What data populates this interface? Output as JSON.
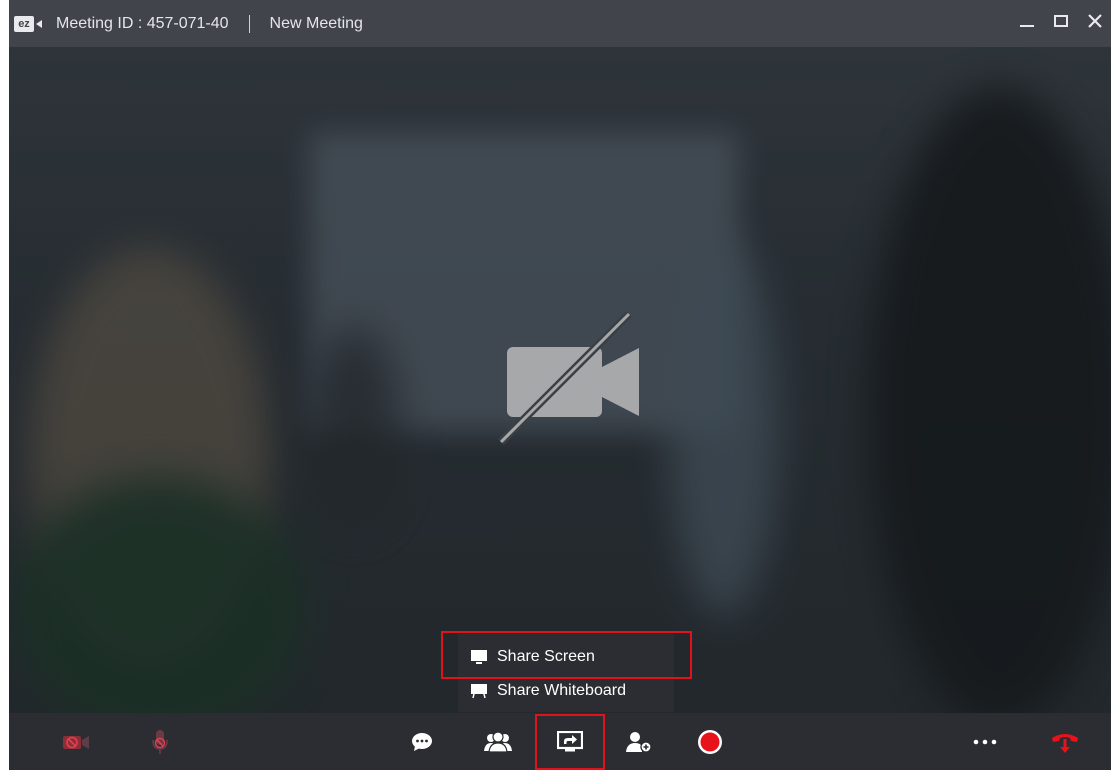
{
  "titlebar": {
    "logo_text": "ez",
    "meeting_id": "Meeting ID : 457-071-40",
    "meeting_name": "New Meeting"
  },
  "share_menu": {
    "items": [
      {
        "label": "Share Screen",
        "icon": "monitor-icon"
      },
      {
        "label": "Share Whiteboard",
        "icon": "whiteboard-icon"
      }
    ]
  },
  "toolbar": {
    "buttons": [
      {
        "name": "video-off-button",
        "icon": "video-off-icon"
      },
      {
        "name": "mic-off-button",
        "icon": "mic-off-icon"
      },
      {
        "name": "chat-button",
        "icon": "chat-bubble-icon"
      },
      {
        "name": "participants-button",
        "icon": "people-icon"
      },
      {
        "name": "share-button",
        "icon": "share-screen-icon"
      },
      {
        "name": "invite-button",
        "icon": "add-person-icon"
      },
      {
        "name": "record-button",
        "icon": "record-icon"
      },
      {
        "name": "more-button",
        "icon": "more-dots-icon"
      },
      {
        "name": "end-call-button",
        "icon": "hang-up-icon"
      }
    ]
  },
  "colors": {
    "titlebar": "#41444b",
    "toolbar": "#2b2d33",
    "highlight": "#e0121b",
    "record": "#e8121a",
    "disabled_icon": "#c43a44"
  }
}
